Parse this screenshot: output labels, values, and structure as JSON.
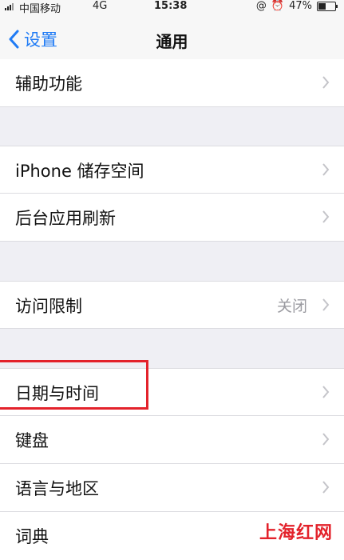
{
  "status_bar": {
    "carrier": "中国移动",
    "network": "4G",
    "time": "15:38",
    "battery": "47%",
    "battery_level": 0.47,
    "icons": [
      "signal-icon",
      "at-icon",
      "alarm-icon",
      "battery-icon"
    ]
  },
  "navbar": {
    "back_label": "设置",
    "title": "通用"
  },
  "rows": [
    {
      "label": "辅助功能"
    },
    {
      "label": "iPhone 储存空间"
    },
    {
      "label": "后台应用刷新"
    },
    {
      "label": "访问限制",
      "value": "关闭"
    },
    {
      "label": "日期与时间"
    },
    {
      "label": "键盘"
    },
    {
      "label": "语言与地区"
    },
    {
      "label": "词典"
    }
  ],
  "watermark": "上海红网",
  "colors": {
    "accent": "#1f7bf5",
    "highlight": "#e3222b",
    "group_background": "#efeff4"
  }
}
